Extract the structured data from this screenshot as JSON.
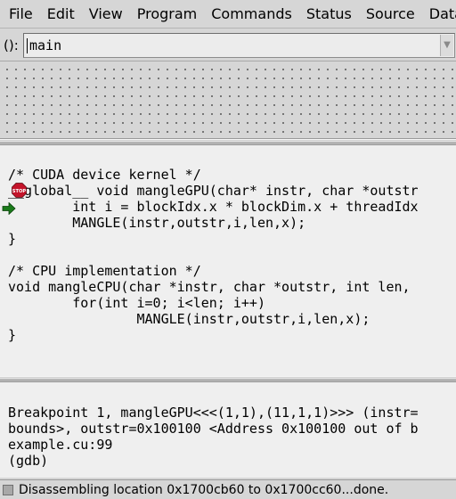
{
  "menubar": {
    "items": [
      {
        "label": "File"
      },
      {
        "label": "Edit"
      },
      {
        "label": "View"
      },
      {
        "label": "Program"
      },
      {
        "label": "Commands"
      },
      {
        "label": "Status"
      },
      {
        "label": "Source"
      },
      {
        "label": "Data"
      }
    ]
  },
  "argument": {
    "label": "():",
    "value": "main"
  },
  "source": {
    "lines": [
      "",
      "/* CUDA device kernel */",
      "__global__ void mangleGPU(char* instr, char *outstr",
      "        int i = blockIdx.x * blockDim.x + threadIdx",
      "        MANGLE(instr,outstr,i,len,x);",
      "}",
      "",
      "/* CPU implementation */",
      "void mangleCPU(char *instr, char *outstr, int len,",
      "        for(int i=0; i<len; i++)",
      "                MANGLE(instr,outstr,i,len,x);",
      "}"
    ],
    "breakpoint_label": "STOP"
  },
  "console": {
    "lines": [
      "Breakpoint 1, mangleGPU<<<(1,1),(11,1,1)>>> (instr=",
      "bounds>, outstr=0x100100 <Address 0x100100 out of b",
      "example.cu:99",
      "(gdb)"
    ]
  },
  "status": {
    "text": "Disassembling location 0x1700cb60 to 0x1700cc60...done."
  },
  "colors": {
    "stop_sign": "#c4142a",
    "exec_arrow": "#1a7a1a",
    "panel_bg": "#d6d6d6",
    "text_bg": "#efefef"
  }
}
